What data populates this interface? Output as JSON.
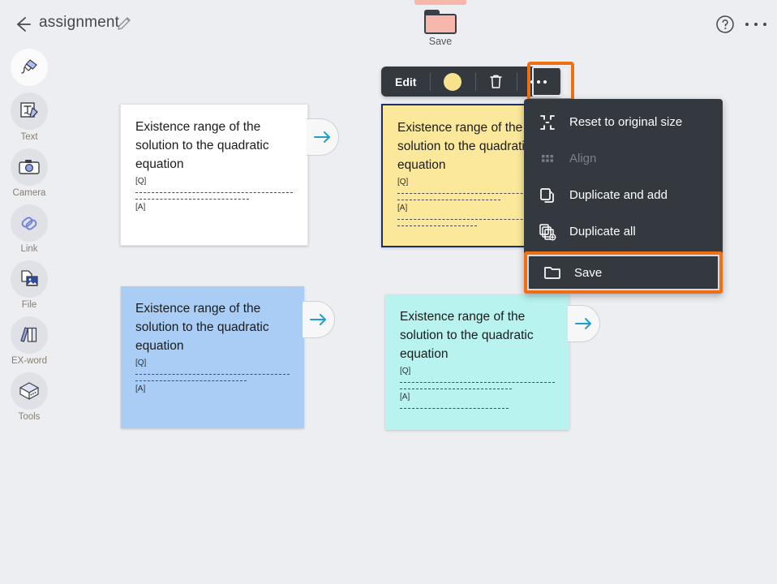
{
  "header": {
    "back_icon": "back-arrow-icon",
    "title": "assignment",
    "edit_icon": "pencil-icon",
    "help_icon": "help-circle-icon",
    "more_icon": "more-horizontal-icon"
  },
  "save_drop": {
    "icon": "folder-icon",
    "label": "Save"
  },
  "card_toolbar": {
    "edit_label": "Edit",
    "color_swatch": "#f7e38e",
    "color_icon": "color-circle-icon",
    "delete_icon": "trash-icon",
    "more_icon": "more-horizontal-icon",
    "highlight_color": "#ed7014"
  },
  "context_menu": {
    "items": [
      {
        "label": "Reset to original size",
        "icon": "collapse-icon",
        "disabled": false,
        "highlighted": false
      },
      {
        "label": "Align",
        "icon": "grid-icon",
        "disabled": true,
        "highlighted": false
      },
      {
        "label": "Duplicate and add",
        "icon": "copy-icon",
        "disabled": false,
        "highlighted": false
      },
      {
        "label": "Duplicate all",
        "icon": "copy-all-icon",
        "disabled": false,
        "highlighted": false
      }
    ],
    "save_item": {
      "label": "Save",
      "icon": "folder-icon",
      "highlighted": true
    }
  },
  "cards": [
    {
      "color": "#ffffff",
      "title": "Existence range of the solution to the quadratic equation",
      "q_tag": "[Q]",
      "a_tag": "[A]",
      "selected": false,
      "arrow_icon": "arrow-right-icon"
    },
    {
      "color": "#fbe89a",
      "title": "Existence range of the solution to the quadratic equation",
      "q_tag": "[Q]",
      "a_tag": "[A]",
      "selected": true,
      "arrow_icon": "arrow-right-icon"
    },
    {
      "color": "#a9cdf4",
      "title": "Existence range of the solution to the quadratic equation",
      "q_tag": "[Q]",
      "a_tag": "[A]",
      "selected": false,
      "arrow_icon": "arrow-right-icon"
    },
    {
      "color": "#b8f3f0",
      "title": "Existence range of the solution to the quadratic equation",
      "q_tag": "[Q]",
      "a_tag": "[A]",
      "selected": false,
      "arrow_icon": "arrow-right-icon"
    }
  ],
  "sidebar": {
    "items": [
      {
        "label": "",
        "icon": "marker-pen-icon",
        "active": true
      },
      {
        "label": "Text",
        "icon": "text-icon",
        "active": false
      },
      {
        "label": "Camera",
        "icon": "camera-icon",
        "active": false
      },
      {
        "label": "Link",
        "icon": "link-icon",
        "active": false
      },
      {
        "label": "File",
        "icon": "file-icon",
        "active": false
      },
      {
        "label": "EX-word",
        "icon": "exword-books-icon",
        "active": false
      },
      {
        "label": "Tools",
        "icon": "tools-box-icon",
        "active": false
      }
    ]
  }
}
